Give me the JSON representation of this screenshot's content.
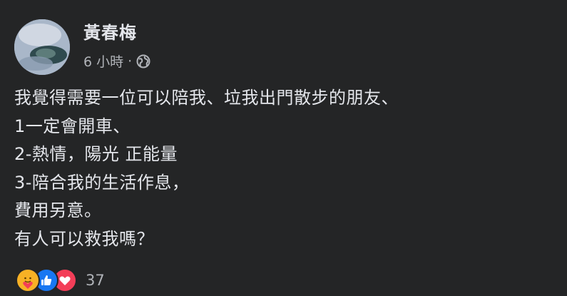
{
  "post": {
    "author": "黃春梅",
    "timestamp": "6 小時",
    "separator": "·",
    "privacy_icon": "globe-icon",
    "lines": [
      "我覺得需要一位可以陪我、垃我出門散步的朋友、",
      "1一定會開車、",
      "2-熱情，陽光 正能量",
      "3-陪合我的生活作息，",
      "費用另意。",
      "有人可以救我嗎？"
    ],
    "reactions": {
      "icons": [
        "care-icon",
        "like-icon",
        "love-icon"
      ],
      "count": "37"
    }
  },
  "colors": {
    "background": "#242526",
    "primary_text": "#e4e6eb",
    "secondary_text": "#b0b3b8",
    "like": "#1877f2",
    "love": "#f33e58",
    "care": "#f7b125"
  }
}
